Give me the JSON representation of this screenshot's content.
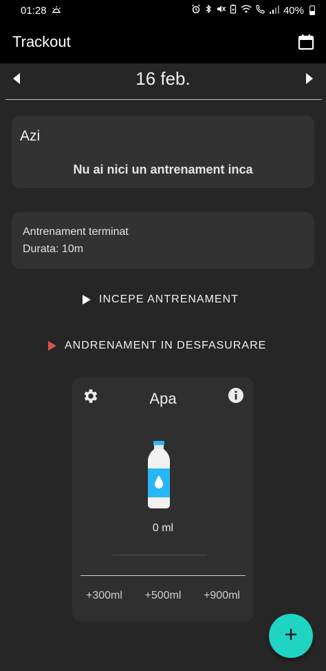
{
  "status_bar": {
    "time": "01:28",
    "battery": "40%",
    "icons": [
      "weather-icon",
      "alarm-icon",
      "bluetooth-icon",
      "mute-icon",
      "battery-saver-icon",
      "wifi-icon",
      "call-icon",
      "signal-icon",
      "battery-icon"
    ]
  },
  "app_bar": {
    "title": "Trackout",
    "action_icon": "calendar-icon"
  },
  "date_nav": {
    "date": "16 feb.",
    "prev_icon": "arrow-left-icon",
    "next_icon": "arrow-right-icon"
  },
  "today_card": {
    "title": "Azi",
    "message": "Nu ai nici un antrenament inca"
  },
  "finished_card": {
    "line1": "Antrenament terminat",
    "line2": "Durata: 10m"
  },
  "actions": {
    "start_label": "INCEPE ANTRENAMENT",
    "running_label": "ANDRENAMENT IN DESFASURARE"
  },
  "water_card": {
    "title": "Apa",
    "amount": "0 ml",
    "progress": 0,
    "quick_add": [
      "+300ml",
      "+500ml",
      "+900ml"
    ],
    "settings_icon": "gear-icon",
    "info_icon": "info-icon",
    "bottle_icon": "water-bottle-icon"
  },
  "fab": {
    "icon": "plus-icon"
  },
  "colors": {
    "background": "#262626",
    "card": "#323232",
    "accent": "#20d4c4",
    "running_indicator": "#d9534f"
  }
}
